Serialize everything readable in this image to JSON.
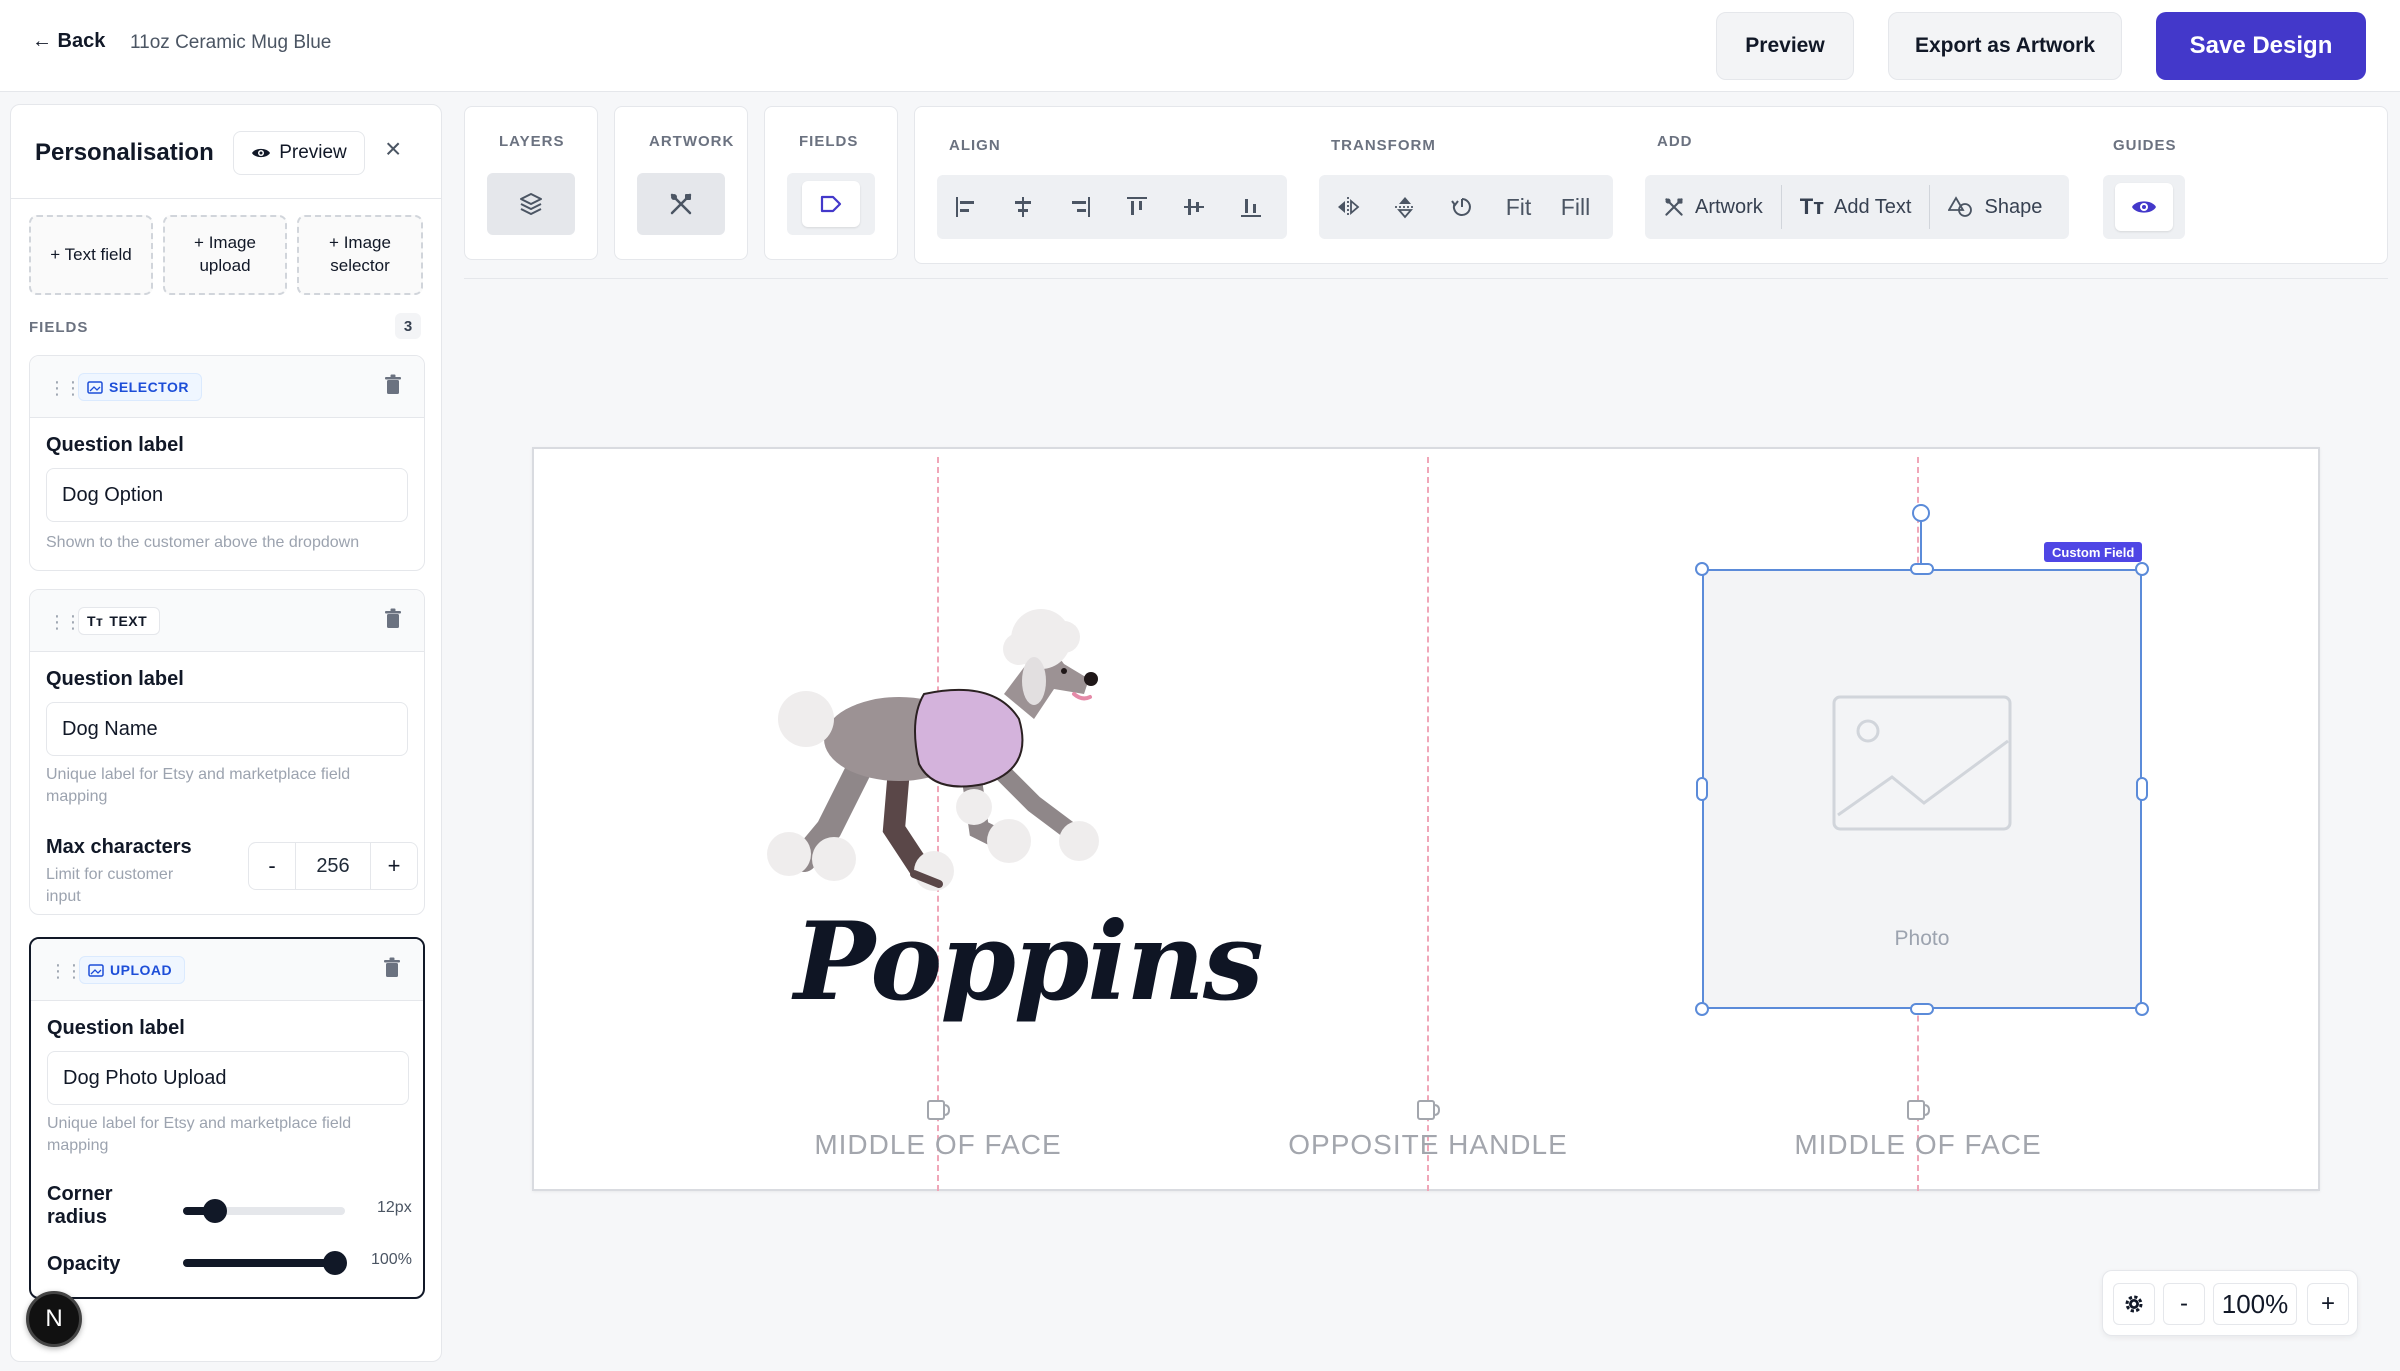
{
  "header": {
    "back_label": "← Back",
    "product_name": "11oz Ceramic Mug Blue",
    "preview_label": "Preview",
    "export_label": "Export as Artwork",
    "save_label": "Save Design"
  },
  "panel": {
    "title": "Personalisation",
    "preview_label": "Preview",
    "close_glyph": "×",
    "add_buttons": [
      {
        "line1": "+ Text field",
        "line2": ""
      },
      {
        "line1": "+ Image",
        "line2": "upload"
      },
      {
        "line1": "+ Image",
        "line2": "selector"
      }
    ],
    "fields_label": "FIELDS",
    "fields_count": "3",
    "fields": [
      {
        "type": "SELECTOR",
        "question_label": "Question label",
        "value": "Dog Option",
        "hint": "Shown to the customer above the dropdown"
      },
      {
        "type": "TEXT",
        "question_label": "Question label",
        "value": "Dog Name",
        "hint": "Unique label for Etsy and marketplace field mapping",
        "max_chars_label": "Max characters",
        "max_chars_hint": "Limit for customer input",
        "max_chars_value": "256",
        "minus": "-",
        "plus": "+"
      },
      {
        "type": "UPLOAD",
        "question_label": "Question label",
        "value": "Dog Photo Upload",
        "hint": "Unique label for Etsy and marketplace field mapping",
        "corner_label_1": "Corner",
        "corner_label_2": "radius",
        "corner_value": "12px",
        "corner_fraction": 0.2,
        "opacity_label": "Opacity",
        "opacity_value": "100%",
        "opacity_fraction": 1.0
      }
    ],
    "avatar_letter": "N"
  },
  "toolbar": {
    "layers": "LAYERS",
    "artwork": "ARTWORK",
    "fields": "FIELDS",
    "align": "ALIGN",
    "transform": "TRANSFORM",
    "add": "ADD",
    "guides": "GUIDES",
    "fit": "Fit",
    "fill": "Fill",
    "add_artwork": "Artwork",
    "add_text": "Add Text",
    "add_shape": "Shape"
  },
  "canvas": {
    "text": "Poppins",
    "face_labels": [
      "MIDDLE OF FACE",
      "OPPOSITE HANDLE",
      "MIDDLE OF FACE"
    ],
    "custom_field_tag": "Custom Field",
    "photo_label": "Photo"
  },
  "zoom": {
    "value": "100%",
    "minus": "-",
    "plus": "+"
  },
  "colors": {
    "primary": "#4338ca",
    "selection": "#5b8bd9",
    "guide": "#f0a6b8",
    "badge_blue": "#1d4ed8"
  }
}
